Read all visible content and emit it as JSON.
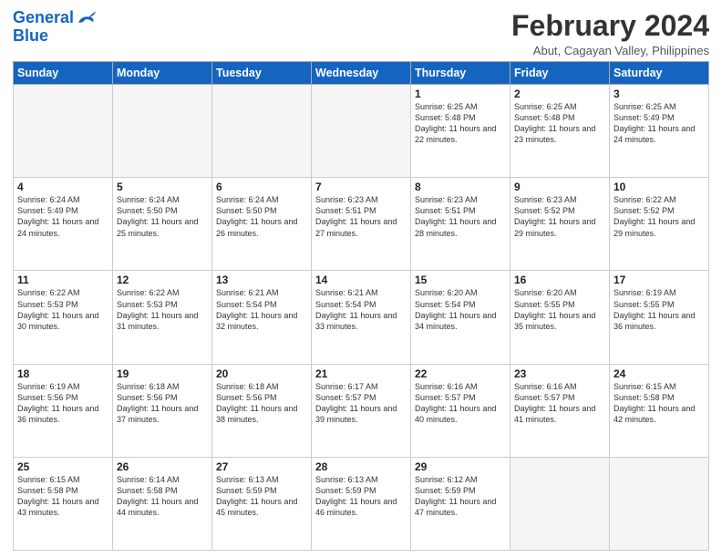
{
  "logo": {
    "text1": "General",
    "text2": "Blue"
  },
  "title": "February 2024",
  "subtitle": "Abut, Cagayan Valley, Philippines",
  "days_of_week": [
    "Sunday",
    "Monday",
    "Tuesday",
    "Wednesday",
    "Thursday",
    "Friday",
    "Saturday"
  ],
  "weeks": [
    [
      {
        "day": "",
        "info": ""
      },
      {
        "day": "",
        "info": ""
      },
      {
        "day": "",
        "info": ""
      },
      {
        "day": "",
        "info": ""
      },
      {
        "day": "1",
        "info": "Sunrise: 6:25 AM\nSunset: 5:48 PM\nDaylight: 11 hours and 22 minutes."
      },
      {
        "day": "2",
        "info": "Sunrise: 6:25 AM\nSunset: 5:48 PM\nDaylight: 11 hours and 23 minutes."
      },
      {
        "day": "3",
        "info": "Sunrise: 6:25 AM\nSunset: 5:49 PM\nDaylight: 11 hours and 24 minutes."
      }
    ],
    [
      {
        "day": "4",
        "info": "Sunrise: 6:24 AM\nSunset: 5:49 PM\nDaylight: 11 hours and 24 minutes."
      },
      {
        "day": "5",
        "info": "Sunrise: 6:24 AM\nSunset: 5:50 PM\nDaylight: 11 hours and 25 minutes."
      },
      {
        "day": "6",
        "info": "Sunrise: 6:24 AM\nSunset: 5:50 PM\nDaylight: 11 hours and 26 minutes."
      },
      {
        "day": "7",
        "info": "Sunrise: 6:23 AM\nSunset: 5:51 PM\nDaylight: 11 hours and 27 minutes."
      },
      {
        "day": "8",
        "info": "Sunrise: 6:23 AM\nSunset: 5:51 PM\nDaylight: 11 hours and 28 minutes."
      },
      {
        "day": "9",
        "info": "Sunrise: 6:23 AM\nSunset: 5:52 PM\nDaylight: 11 hours and 29 minutes."
      },
      {
        "day": "10",
        "info": "Sunrise: 6:22 AM\nSunset: 5:52 PM\nDaylight: 11 hours and 29 minutes."
      }
    ],
    [
      {
        "day": "11",
        "info": "Sunrise: 6:22 AM\nSunset: 5:53 PM\nDaylight: 11 hours and 30 minutes."
      },
      {
        "day": "12",
        "info": "Sunrise: 6:22 AM\nSunset: 5:53 PM\nDaylight: 11 hours and 31 minutes."
      },
      {
        "day": "13",
        "info": "Sunrise: 6:21 AM\nSunset: 5:54 PM\nDaylight: 11 hours and 32 minutes."
      },
      {
        "day": "14",
        "info": "Sunrise: 6:21 AM\nSunset: 5:54 PM\nDaylight: 11 hours and 33 minutes."
      },
      {
        "day": "15",
        "info": "Sunrise: 6:20 AM\nSunset: 5:54 PM\nDaylight: 11 hours and 34 minutes."
      },
      {
        "day": "16",
        "info": "Sunrise: 6:20 AM\nSunset: 5:55 PM\nDaylight: 11 hours and 35 minutes."
      },
      {
        "day": "17",
        "info": "Sunrise: 6:19 AM\nSunset: 5:55 PM\nDaylight: 11 hours and 36 minutes."
      }
    ],
    [
      {
        "day": "18",
        "info": "Sunrise: 6:19 AM\nSunset: 5:56 PM\nDaylight: 11 hours and 36 minutes."
      },
      {
        "day": "19",
        "info": "Sunrise: 6:18 AM\nSunset: 5:56 PM\nDaylight: 11 hours and 37 minutes."
      },
      {
        "day": "20",
        "info": "Sunrise: 6:18 AM\nSunset: 5:56 PM\nDaylight: 11 hours and 38 minutes."
      },
      {
        "day": "21",
        "info": "Sunrise: 6:17 AM\nSunset: 5:57 PM\nDaylight: 11 hours and 39 minutes."
      },
      {
        "day": "22",
        "info": "Sunrise: 6:16 AM\nSunset: 5:57 PM\nDaylight: 11 hours and 40 minutes."
      },
      {
        "day": "23",
        "info": "Sunrise: 6:16 AM\nSunset: 5:57 PM\nDaylight: 11 hours and 41 minutes."
      },
      {
        "day": "24",
        "info": "Sunrise: 6:15 AM\nSunset: 5:58 PM\nDaylight: 11 hours and 42 minutes."
      }
    ],
    [
      {
        "day": "25",
        "info": "Sunrise: 6:15 AM\nSunset: 5:58 PM\nDaylight: 11 hours and 43 minutes."
      },
      {
        "day": "26",
        "info": "Sunrise: 6:14 AM\nSunset: 5:58 PM\nDaylight: 11 hours and 44 minutes."
      },
      {
        "day": "27",
        "info": "Sunrise: 6:13 AM\nSunset: 5:59 PM\nDaylight: 11 hours and 45 minutes."
      },
      {
        "day": "28",
        "info": "Sunrise: 6:13 AM\nSunset: 5:59 PM\nDaylight: 11 hours and 46 minutes."
      },
      {
        "day": "29",
        "info": "Sunrise: 6:12 AM\nSunset: 5:59 PM\nDaylight: 11 hours and 47 minutes."
      },
      {
        "day": "",
        "info": ""
      },
      {
        "day": "",
        "info": ""
      }
    ]
  ]
}
